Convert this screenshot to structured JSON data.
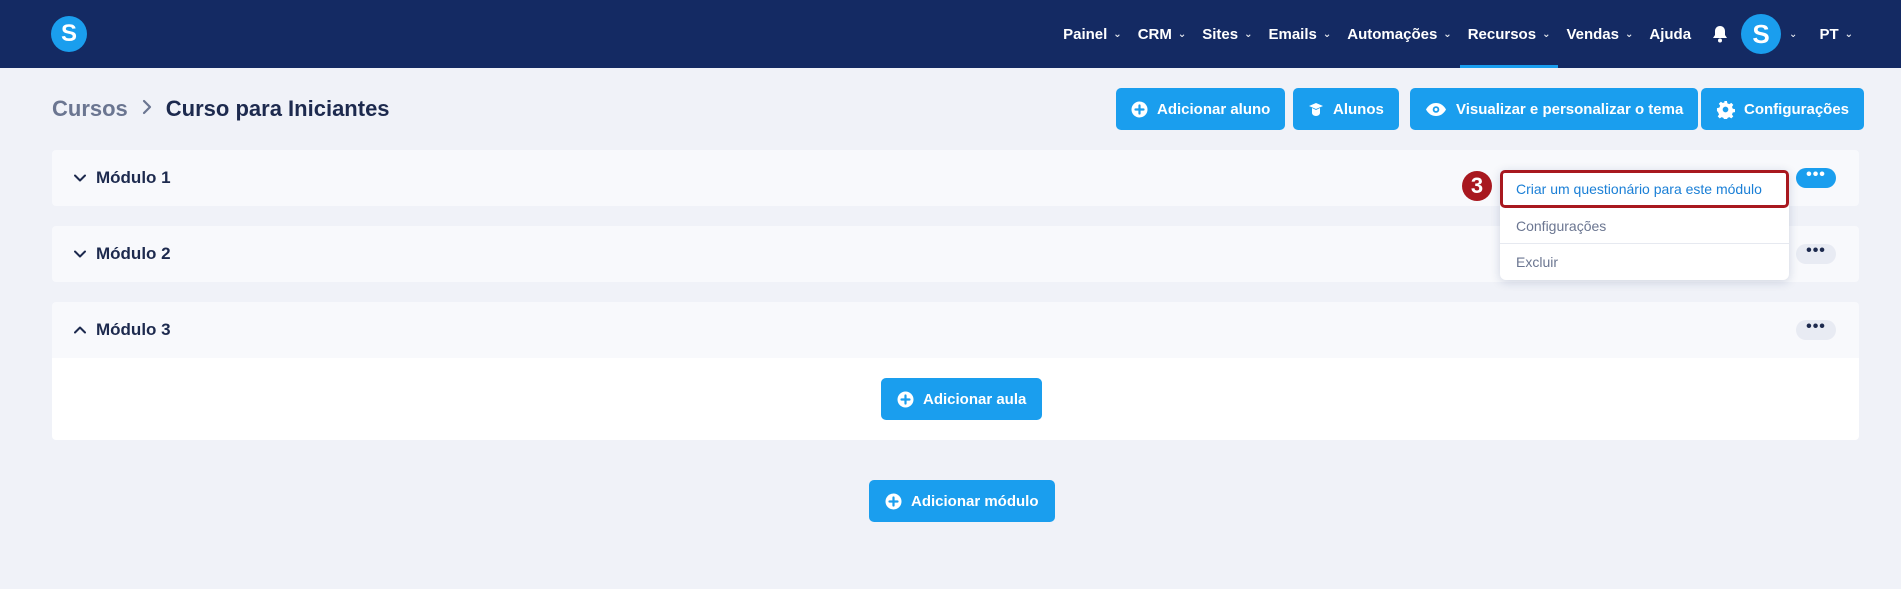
{
  "nav": {
    "items": [
      {
        "label": "Painel",
        "dropdown": true
      },
      {
        "label": "CRM",
        "dropdown": true
      },
      {
        "label": "Sites",
        "dropdown": true
      },
      {
        "label": "Emails",
        "dropdown": true
      },
      {
        "label": "Automações",
        "dropdown": true
      },
      {
        "label": "Recursos",
        "dropdown": true,
        "active": true
      },
      {
        "label": "Vendas",
        "dropdown": true
      },
      {
        "label": "Ajuda",
        "dropdown": false
      }
    ],
    "avatar_letter": "S",
    "language": "PT"
  },
  "logo_letter": "S",
  "breadcrumb": {
    "root": "Cursos",
    "current": "Curso para Iniciantes"
  },
  "header_buttons": {
    "add_student": "Adicionar aluno",
    "students": "Alunos",
    "theme": "Visualizar e personalizar o tema",
    "settings": "Configurações"
  },
  "modules": [
    {
      "title": "Módulo 1",
      "expanded": false
    },
    {
      "title": "Módulo 2",
      "expanded": false
    },
    {
      "title": "Módulo 3",
      "expanded": true
    }
  ],
  "module_menu_label": "•••",
  "add_lesson": "Adicionar aula",
  "add_module": "Adicionar módulo",
  "dropdown": {
    "items": [
      {
        "label": "Criar um questionário para este módulo",
        "highlight": true
      },
      {
        "label": "Configurações",
        "highlight": false
      },
      {
        "label": "Excluir",
        "highlight": false
      }
    ]
  },
  "step_badge": "3",
  "colors": {
    "nav_bg": "#142a63",
    "accent": "#1a9eee",
    "highlight_border": "#a8181f",
    "page_bg": "#f0f2f8"
  }
}
